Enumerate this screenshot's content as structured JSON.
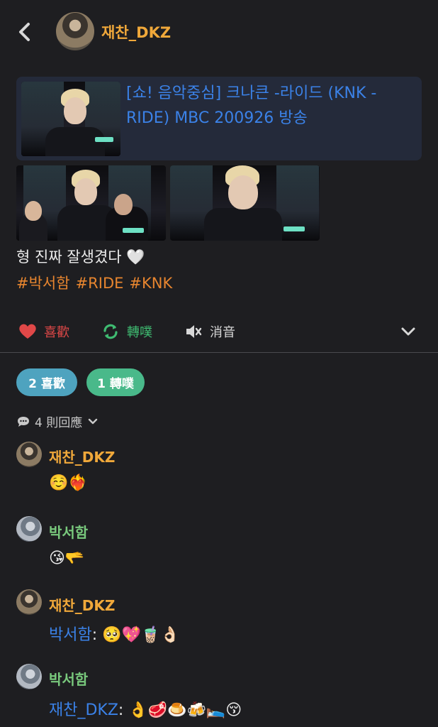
{
  "header": {
    "username": "재찬_DKZ"
  },
  "link_card": {
    "title": "[쇼! 음악중심] 크나큰 -라이드 (KNK -RIDE) MBC 200926 방송"
  },
  "post": {
    "text": "형 진짜 잘생겼다 🤍",
    "hashtags": [
      "#박서함",
      "#RIDE",
      "#KNK"
    ]
  },
  "actions": {
    "like": "喜歡",
    "repost": "轉噗",
    "mute": "消音"
  },
  "stats": {
    "likes": "2 喜歡",
    "reposts": "1 轉噗"
  },
  "replies": {
    "label": "4 則回應"
  },
  "comments": [
    {
      "author": "재찬_DKZ",
      "mention": "",
      "body": "☺️❤️‍🔥"
    },
    {
      "author": "박서함",
      "mention": "",
      "body": "😘🫳"
    },
    {
      "author": "재찬_DKZ",
      "mention": "박서함",
      "body": ": 🥺💖🧋👌🏻"
    },
    {
      "author": "박서함",
      "mention": "재찬_DKZ",
      "body": ": 👌🥩🍮🍻🛌😚"
    }
  ],
  "colors": {
    "background": "#1e1e21",
    "username_orange": "#f0a83a",
    "link_blue": "#3b82e8",
    "hashtag_orange": "#e7852f",
    "like_red": "#e04848",
    "repost_green": "#3fbb71",
    "pill_likes": "#4ea3bf",
    "pill_reposts": "#49b98a",
    "name_green": "#79c97d"
  },
  "icons": {
    "back": "chevron-left-icon",
    "like": "heart-icon",
    "repost": "repost-arrows-icon",
    "mute": "speaker-mute-icon",
    "more": "chevron-down-icon",
    "replies": "speech-bubble-icon"
  }
}
